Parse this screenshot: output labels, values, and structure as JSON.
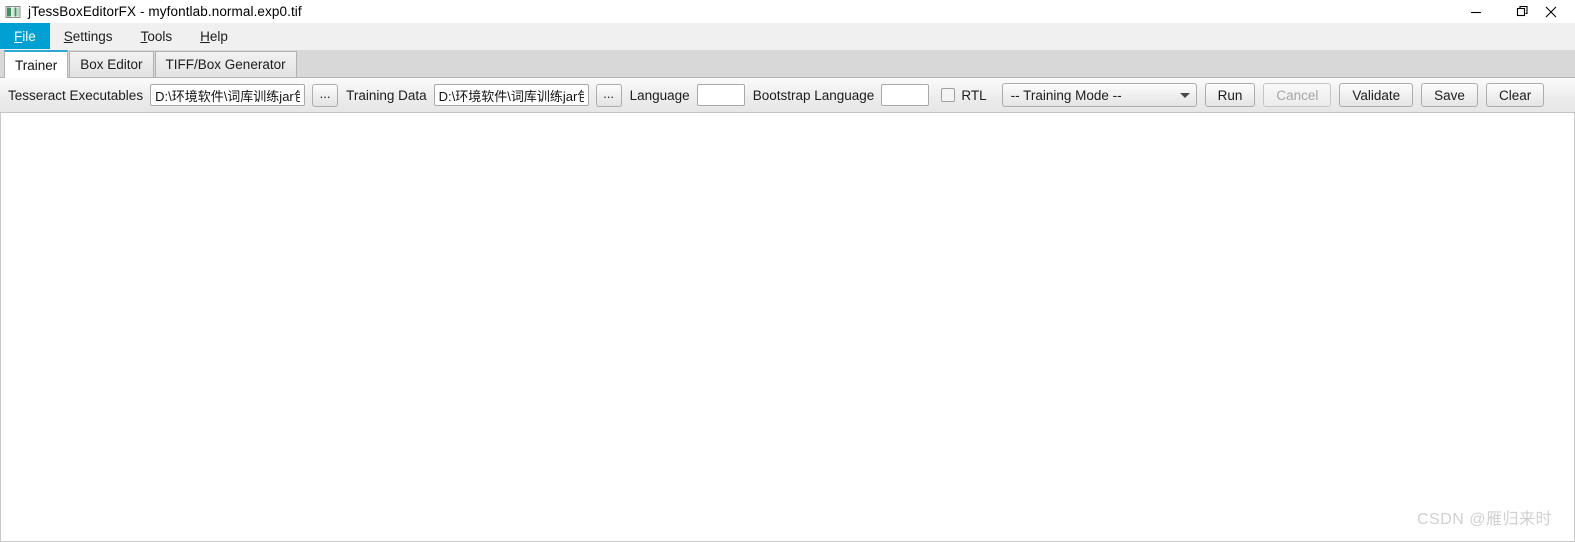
{
  "window": {
    "title": "jTessBoxEditorFX - myfontlab.normal.exp0.tif",
    "app_icon": "image-icon",
    "controls": {
      "minimize": "minimize-icon",
      "maximize": "maximize-icon",
      "close": "close-icon"
    }
  },
  "menubar": {
    "items": [
      {
        "label": "File",
        "mnemonic": "F",
        "active": true
      },
      {
        "label": "Settings",
        "mnemonic": "S",
        "active": false
      },
      {
        "label": "Tools",
        "mnemonic": "T",
        "active": false
      },
      {
        "label": "Help",
        "mnemonic": "H",
        "active": false
      }
    ],
    "active_bg": "#00a0d2"
  },
  "tabs": [
    {
      "label": "Trainer",
      "selected": true
    },
    {
      "label": "Box Editor",
      "selected": false
    },
    {
      "label": "TIFF/Box Generator",
      "selected": false
    }
  ],
  "tab_accent": "#2fa8d6",
  "toolbar": {
    "tesseract_executables_label": "Tesseract Executables",
    "tesseract_executables_value": "D:\\环境软件\\词库训练jar包\\",
    "tesseract_browse_label": "...",
    "training_data_label": "Training Data",
    "training_data_value": "D:\\环境软件\\词库训练jar包\\",
    "training_data_browse_label": "...",
    "language_label": "Language",
    "language_value": "",
    "language_placeholder": "",
    "bootstrap_language_label": "Bootstrap Language",
    "bootstrap_language_value": "",
    "bootstrap_language_placeholder": "",
    "rtl_label": "RTL",
    "rtl_checked": false,
    "training_mode_value": "-- Training Mode --",
    "training_mode_options": [
      "-- Training Mode --"
    ],
    "run_label": "Run",
    "cancel_label": "Cancel",
    "cancel_disabled": true,
    "validate_label": "Validate",
    "save_label": "Save",
    "clear_label": "Clear"
  },
  "content": {
    "watermark": "CSDN @雁归来时"
  }
}
